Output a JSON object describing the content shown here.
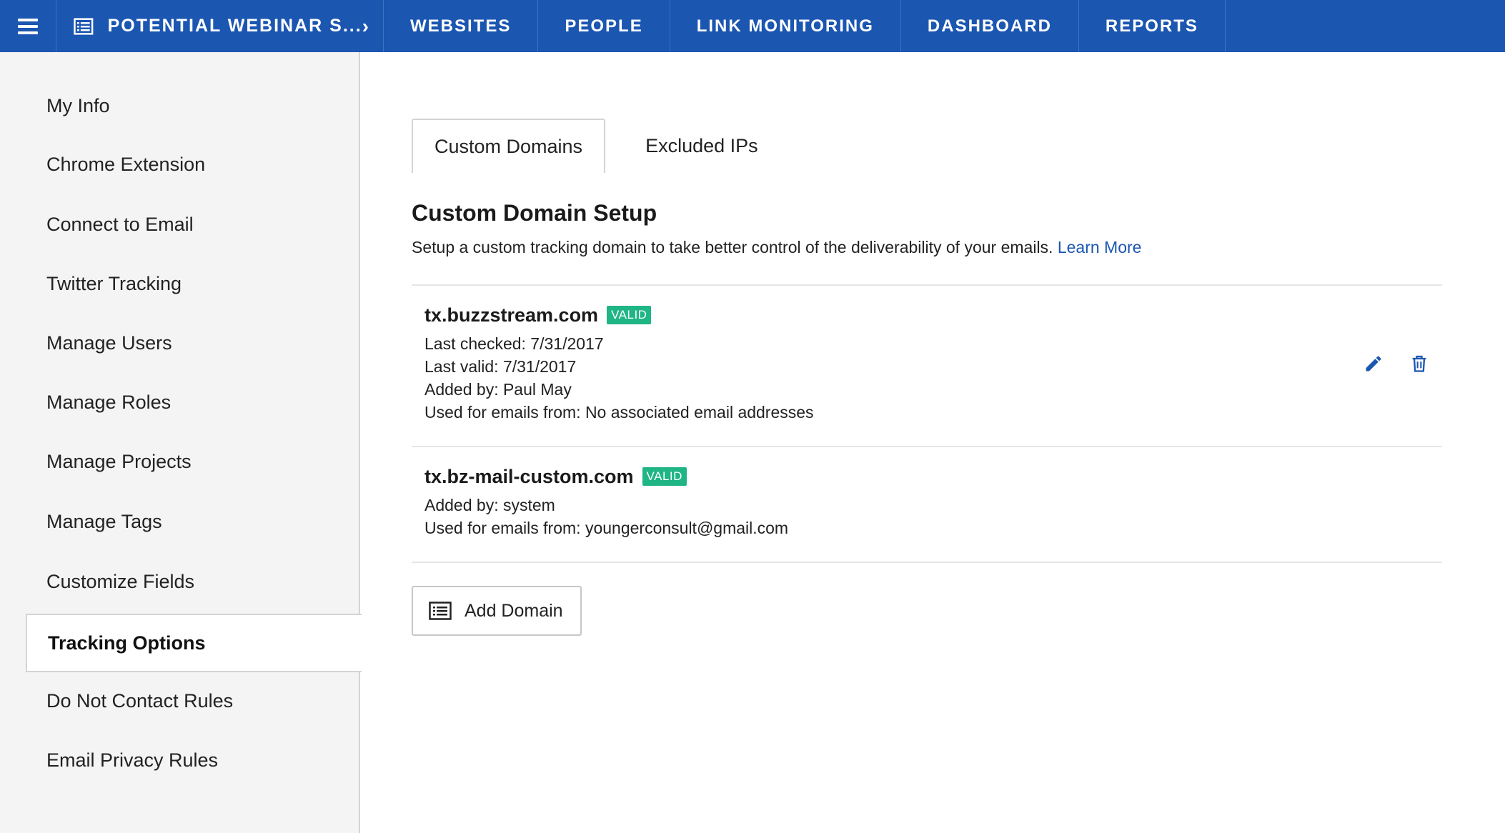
{
  "topbar": {
    "menu_icon": "hamburger-icon",
    "project_icon": "list-icon",
    "project_name": "POTENTIAL WEBINAR S...",
    "chevron": "›",
    "nav": [
      "WEBSITES",
      "PEOPLE",
      "LINK MONITORING",
      "DASHBOARD",
      "REPORTS"
    ],
    "bg_color": "#1b56b1"
  },
  "sidebar": {
    "items": [
      {
        "label": "My Info"
      },
      {
        "label": "Chrome Extension"
      },
      {
        "label": "Connect to Email"
      },
      {
        "label": "Twitter Tracking"
      },
      {
        "label": "Manage Users"
      },
      {
        "label": "Manage Roles"
      },
      {
        "label": "Manage Projects"
      },
      {
        "label": "Manage Tags"
      },
      {
        "label": "Customize Fields"
      },
      {
        "label": "Tracking Options",
        "active": true
      },
      {
        "label": "Do Not Contact Rules"
      },
      {
        "label": "Email Privacy Rules"
      }
    ]
  },
  "main": {
    "tabs": [
      {
        "label": "Custom Domains",
        "active": true
      },
      {
        "label": "Excluded IPs",
        "active": false
      }
    ],
    "title": "Custom Domain Setup",
    "description": "Setup a custom tracking domain to take better control of the deliverability of your emails.",
    "learn_more": "Learn More",
    "domains": [
      {
        "name": "tx.buzzstream.com",
        "status": "VALID",
        "details": [
          "Last checked: 7/31/2017",
          "Last valid: 7/31/2017",
          "Added by: Paul May",
          "Used for emails from: No associated email addresses"
        ],
        "actions": [
          "pencil-icon",
          "trash-icon"
        ]
      },
      {
        "name": "tx.bz-mail-custom.com",
        "status": "VALID",
        "details": [
          "Added by: system",
          "Used for emails from: youngerconsult@gmail.com"
        ]
      }
    ],
    "add_button": "Add Domain",
    "colors": {
      "link": "#1b56b1",
      "valid_badge": "#1fb584"
    }
  }
}
